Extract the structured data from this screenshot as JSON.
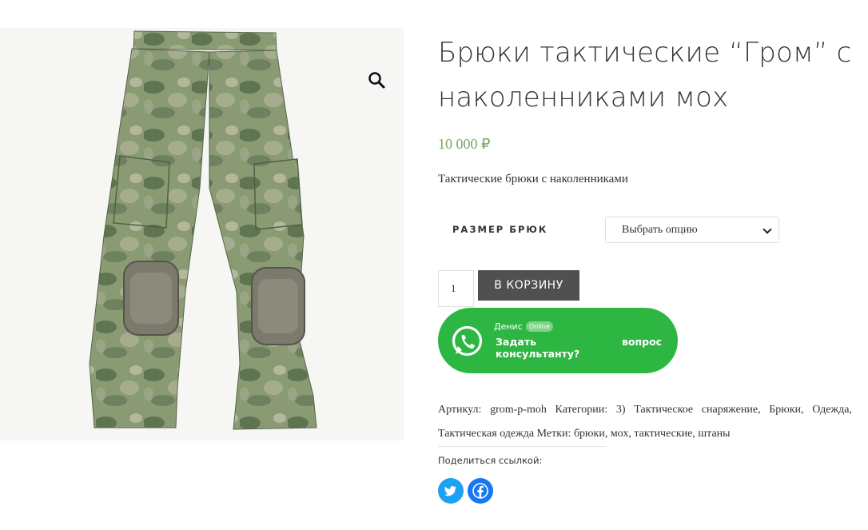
{
  "product": {
    "title": "Брюки тактические “Гром” с наколенниками мох",
    "price": "10 000 ₽",
    "short_description": "Тактические брюки с наколенниками",
    "image_alt": "Камуфляжные тактические брюки с наколенниками"
  },
  "icons": {
    "zoom": "magnifier-icon",
    "whatsapp": "whatsapp-icon",
    "twitter": "twitter-icon",
    "facebook": "facebook-icon"
  },
  "variation": {
    "label": "РАЗМЕР БРЮК",
    "selected_option": "Выбрать опцию"
  },
  "cart": {
    "quantity": "1",
    "add_to_cart_label": "В КОРЗИНУ"
  },
  "whatsapp": {
    "agent_name": "Денис",
    "status_badge": "Online",
    "ask_text": "Задать консультанту?",
    "question_label": "вопрос"
  },
  "meta": {
    "sku_label": "Артикул:",
    "sku": "grom-p-moh",
    "categories_label": "Категории:",
    "categories": "3) Тактическое снаряжение, Брюки, Одежда, Тактическая одежда",
    "tags_label": "Метки:",
    "tags": "брюки, мох, тактические, штаны"
  },
  "share": {
    "title": "Поделиться ссылкой:"
  },
  "colors": {
    "price": "#77a464",
    "add_to_cart_bg": "#505050",
    "whatsapp_green": "#2db742",
    "twitter": "#1da1f2",
    "facebook": "#1877f2"
  }
}
